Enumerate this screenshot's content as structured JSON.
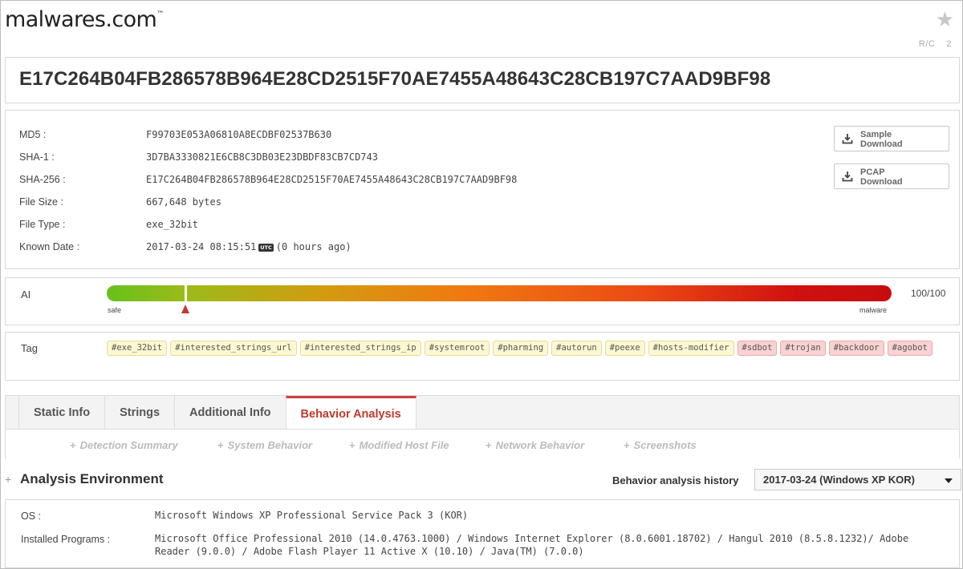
{
  "header": {
    "logo_text": "malwares.com",
    "logo_tm": "™",
    "rc_label": "R/C",
    "rc_count": "2"
  },
  "hash_title": "E17C264B04FB286578B964E28CD2515F70AE7455A48643C28CB197C7AAD9BF98",
  "file_info": [
    {
      "label": "MD5 :",
      "value": "F99703E053A06810A8ECDBF02537B630"
    },
    {
      "label": "SHA-1 :",
      "value": "3D7BA3330821E6CB8C3DB03E23DBDF83CB7CD743"
    },
    {
      "label": "SHA-256 :",
      "value": "E17C264B04FB286578B964E28CD2515F70AE7455A48643C28CB197C7AAD9BF98"
    },
    {
      "label": "File Size :",
      "value": "667,648 bytes"
    },
    {
      "label": "File Type :",
      "value": "exe_32bit"
    },
    {
      "label": "Known Date :",
      "value": "2017-03-24 08:15:51",
      "badge": "UTC",
      "suffix": "(0 hours ago)"
    }
  ],
  "downloads": {
    "sample": {
      "line1": "Sample",
      "line2": "Download",
      "icon": "download-icon"
    },
    "pcap": {
      "line1": "PCAP",
      "line2": "Download",
      "icon": "download-icon"
    }
  },
  "ai": {
    "label": "AI",
    "score": "100/100",
    "marker_fraction": 0.1,
    "low_label": "safe",
    "high_label": "malware"
  },
  "tags": {
    "label": "Tag",
    "items": [
      {
        "text": "#exe_32bit",
        "color": "#fbf8d2"
      },
      {
        "text": "#interested_strings_url",
        "color": "#fbf8d2"
      },
      {
        "text": "#interested_strings_ip",
        "color": "#fbf8d2"
      },
      {
        "text": "#systemroot",
        "color": "#fbf8d2"
      },
      {
        "text": "#pharming",
        "color": "#fbf8d2"
      },
      {
        "text": "#autorun",
        "color": "#fbf8d2"
      },
      {
        "text": "#peexe",
        "color": "#fbf8d2"
      },
      {
        "text": "#hosts-modifier",
        "color": "#fbf8d2"
      },
      {
        "text": "#sdbot",
        "color": "#f9d2d2"
      },
      {
        "text": "#trojan",
        "color": "#f9d2d2"
      },
      {
        "text": "#backdoor",
        "color": "#f9d2d2"
      },
      {
        "text": "#agobot",
        "color": "#f9d2d2"
      }
    ]
  },
  "tabs": [
    {
      "label": "Static Info",
      "active": false
    },
    {
      "label": "Strings",
      "active": false
    },
    {
      "label": "Additional Info",
      "active": false
    },
    {
      "label": "Behavior Analysis",
      "active": true
    }
  ],
  "subtabs": [
    {
      "label": "Detection Summary"
    },
    {
      "label": "System Behavior"
    },
    {
      "label": "Modified Host File"
    },
    {
      "label": "Network Behavior"
    },
    {
      "label": "Screenshots"
    }
  ],
  "environment": {
    "title": "Analysis Environment",
    "history_label": "Behavior analysis history",
    "history_value": "2017-03-24 (Windows XP KOR)",
    "os_label": "OS :",
    "os_value": "Microsoft Windows XP Professional Service Pack 3 (KOR)",
    "programs_label": "Installed Programs :",
    "programs_line1": "Microsoft Office Professional 2010 (14.0.4763.1000) / Windows Internet Explorer (8.0.6001.18702) / Hangul 2010 (8.5.8.1232)/ Adobe",
    "programs_line2": "Reader (9.0.0) / Adobe Flash Player 11 Active X (10.10) / Java(TM) (7.0.0)"
  },
  "colors": {
    "accent": "#c0392b",
    "tag_yellow": "#fbf8d2",
    "tag_red": "#f9d2d2"
  }
}
